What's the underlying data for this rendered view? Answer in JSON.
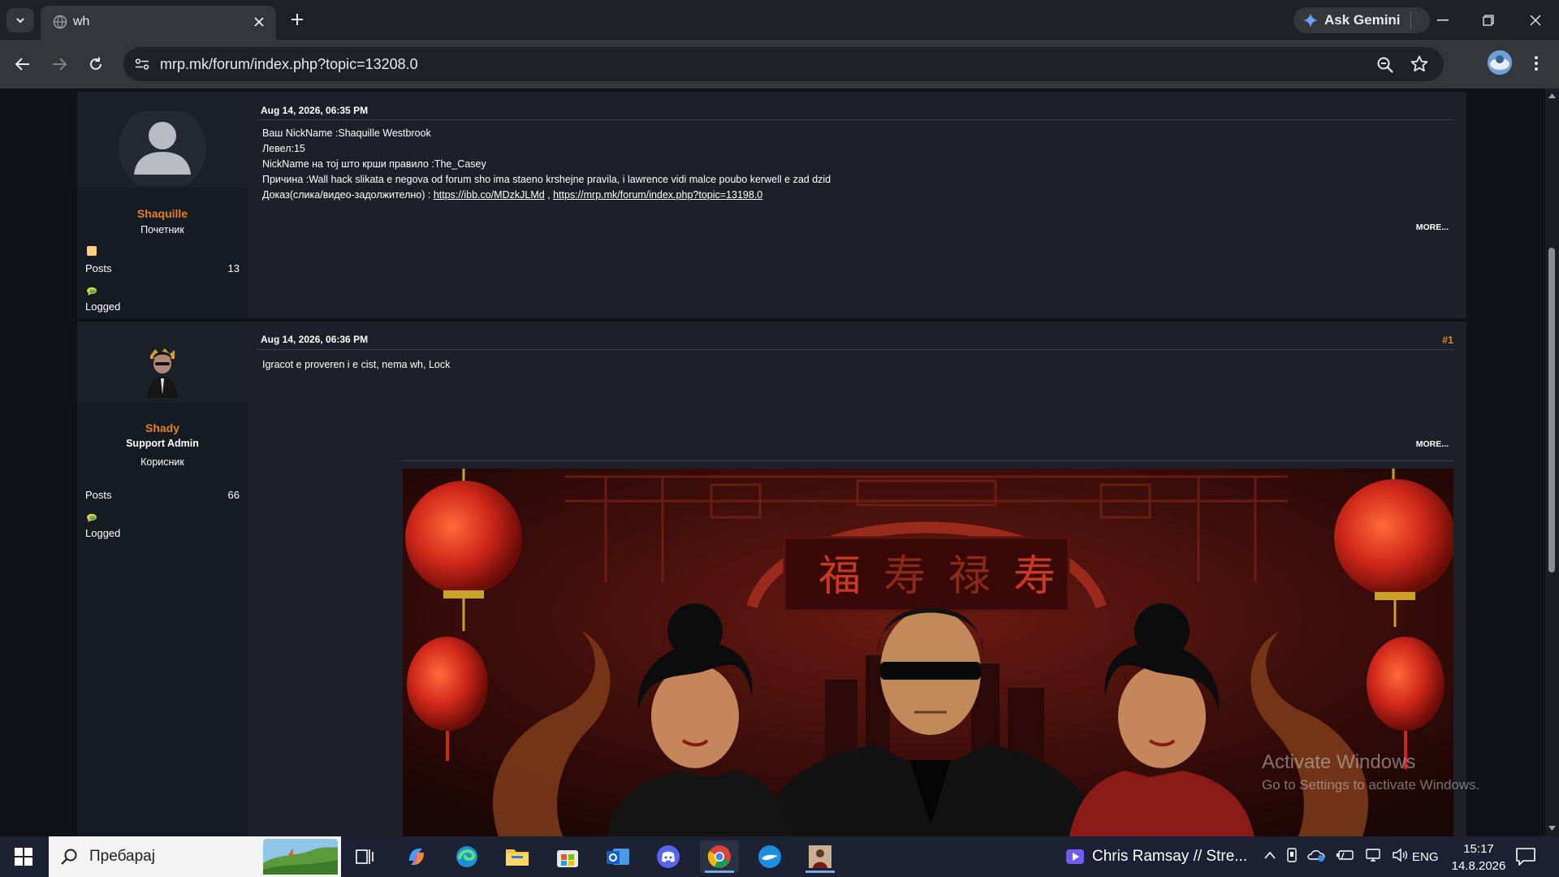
{
  "browser": {
    "tab_title": "wh",
    "url": "mrp.mk/forum/index.php?topic=13208.0",
    "gemini_label": "Ask Gemini"
  },
  "posts": [
    {
      "date": "Aug 14, 2026, 06:35 PM",
      "author": "Shaquille",
      "rank": "Почетник",
      "posts_label": "Posts",
      "posts_count": "13",
      "logged_label": "Logged",
      "lines": [
        "Ваш NickName :Shaquille Westbrook",
        "Левел:15",
        "NickName на тој што крши правило :The_Casey",
        "Причина :Wall hack slikata e negova od forum sho ima staeno krshejne pravila, i lawrence vidi malce poubo kerwell e zad dzid"
      ],
      "proof_prefix": "Доказ(слика/видео-задолжително) : ",
      "proof_link_1": "https://ibb.co/MDzkJLMd",
      "proof_sep": " , ",
      "proof_link_2": "https://mrp.mk/forum/index.php?topic=13198.0",
      "more_label": "MORE..."
    },
    {
      "date": "Aug 14, 2026, 06:36 PM",
      "number": "#1",
      "author": "Shady",
      "group": "Support Admin",
      "rank": "Корисник",
      "posts_label": "Posts",
      "posts_count": "66",
      "logged_label": "Logged",
      "text": "Igracot e proveren i e cist, nema wh, Lock",
      "more_label": "MORE...",
      "signature_chars": "福 寿 禄 寿"
    }
  ],
  "watermark": {
    "title": "Activate Windows",
    "subtitle": "Go to Settings to activate Windows."
  },
  "taskbar": {
    "search_placeholder": "Пребарај",
    "media_text": "Chris Ramsay // Stre...",
    "language": "ENG",
    "time": "15:17",
    "date": "14.8.2026"
  },
  "colors": {
    "username": "#e0832e",
    "post_bg": "#1d2028",
    "poster_bg": "#161a22",
    "page_bg": "#0f1218"
  }
}
